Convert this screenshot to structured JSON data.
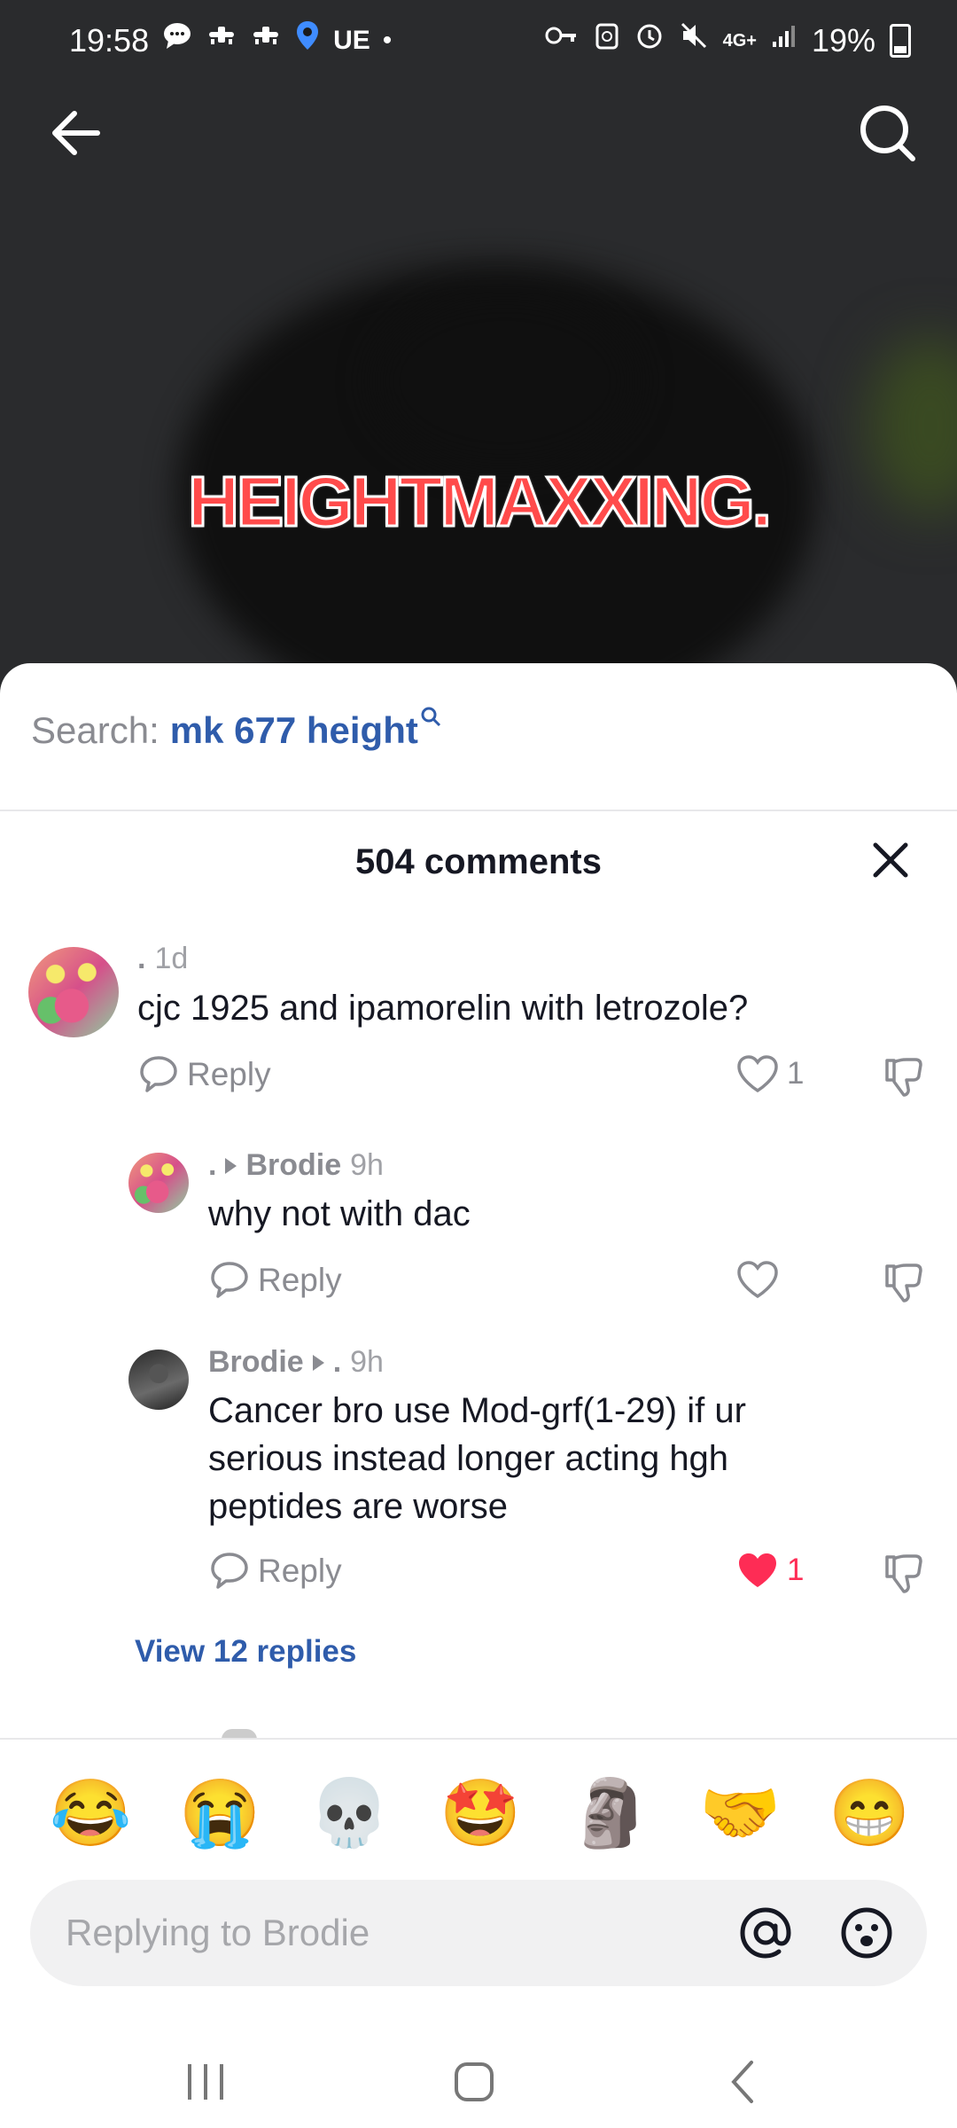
{
  "status_bar": {
    "time": "19:58",
    "carrier": "UE",
    "network": "4G+",
    "battery": "19%"
  },
  "video": {
    "title_overlay": "HEIGHTMAXXING."
  },
  "search": {
    "prefix": "Search:",
    "term": "mk 677 height"
  },
  "comments_header": {
    "count_label": "504 comments"
  },
  "comments": [
    {
      "author": ".",
      "time": "1d",
      "text": "cjc 1925 and ipamorelin with letrozole?",
      "reply_label": "Reply",
      "likes": "1",
      "liked": false
    },
    {
      "author": ".",
      "reply_to": "Brodie",
      "time": "9h",
      "text": "why not with dac",
      "reply_label": "Reply",
      "likes": "",
      "liked": false
    },
    {
      "author": "Brodie",
      "reply_to": ".",
      "time": "9h",
      "text": "Cancer bro use Mod-grf(1-29) if ur serious instead longer acting hgh peptides are worse",
      "reply_label": "Reply",
      "likes": "1",
      "liked": true
    }
  ],
  "view_replies": "View 12 replies",
  "emoji_bar": [
    "😂",
    "😭",
    "💀",
    "🤩",
    "🗿",
    "🤝",
    "😁"
  ],
  "input": {
    "placeholder": "Replying to Brodie"
  },
  "colors": {
    "accent_blue": "#2f5cab",
    "like_red": "#fe2c55",
    "text_primary": "#161823",
    "text_secondary": "#8a8b91"
  }
}
